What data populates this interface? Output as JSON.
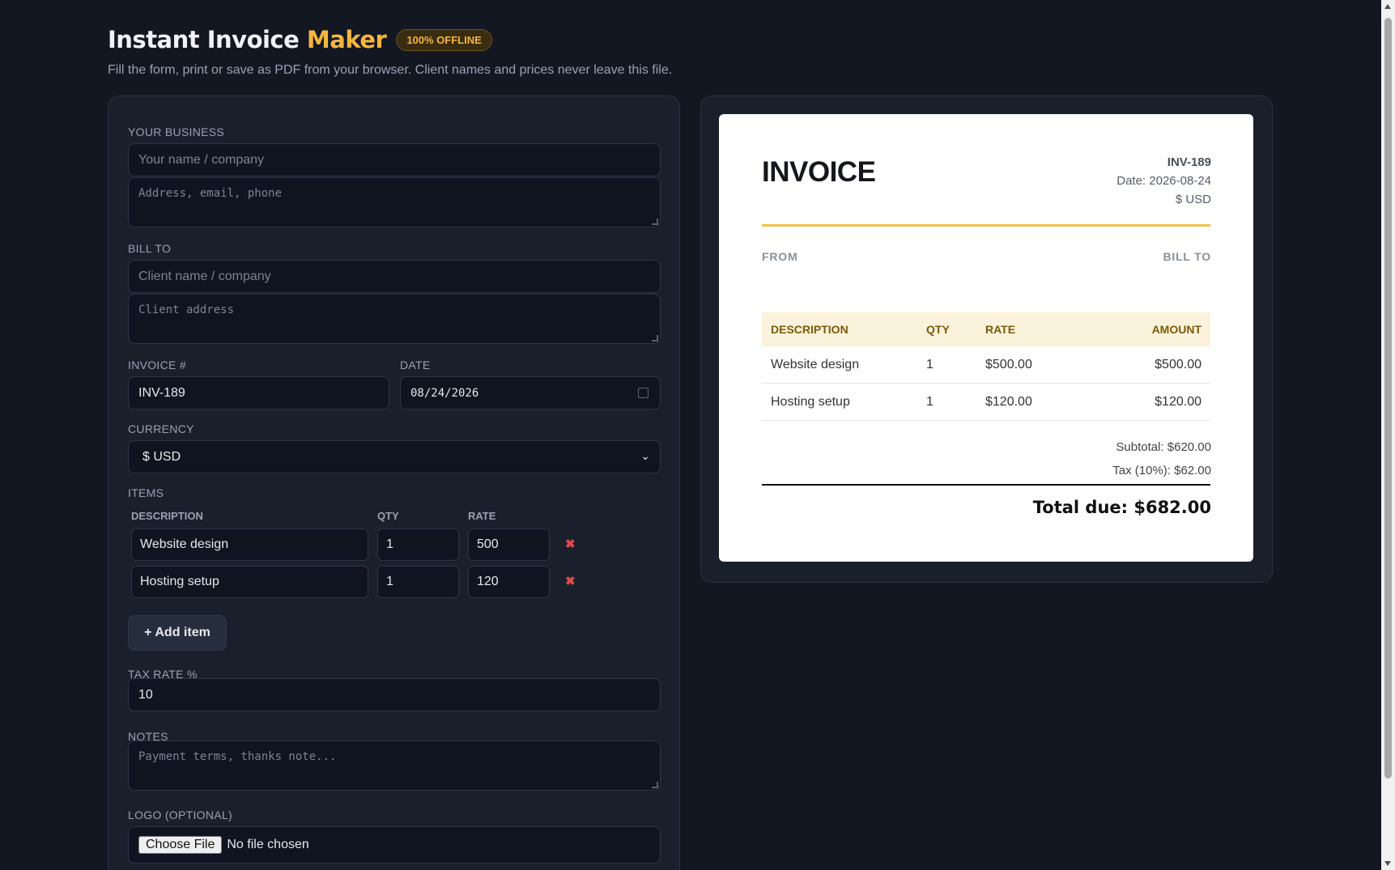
{
  "header": {
    "title_part1": "Instant Invoice",
    "title_accent": "Maker",
    "badge": "100% OFFLINE",
    "subtitle": "Fill the form, print or save as PDF from your browser. Client names and prices never leave this file."
  },
  "form": {
    "business": {
      "label": "YOUR BUSINESS",
      "name_placeholder": "Your name / company",
      "address_placeholder": "Address, email, phone"
    },
    "bill_to": {
      "label": "BILL TO",
      "name_placeholder": "Client name / company",
      "address_placeholder": "Client address"
    },
    "invoice_number": {
      "label": "INVOICE #",
      "value": "INV-189"
    },
    "date": {
      "label": "DATE",
      "value": "08/24/2026"
    },
    "currency": {
      "label": "CURRENCY",
      "value": "$ USD"
    },
    "items": {
      "label": "ITEMS",
      "col_description": "DESCRIPTION",
      "col_qty": "QTY",
      "col_rate": "RATE",
      "rows": [
        {
          "description": "Website design",
          "qty": "1",
          "rate": "500"
        },
        {
          "description": "Hosting setup",
          "qty": "1",
          "rate": "120"
        }
      ],
      "remove_glyph": "✖",
      "add_label": "+ Add item"
    },
    "tax": {
      "label": "TAX RATE %",
      "value": "10"
    },
    "notes": {
      "label": "NOTES",
      "placeholder": "Payment terms, thanks note..."
    },
    "logo": {
      "label": "LOGO (OPTIONAL)",
      "button": "Choose File",
      "status": "No file chosen"
    }
  },
  "preview": {
    "title": "INVOICE",
    "number": "INV-189",
    "date": "Date: 2026-08-24",
    "currency": "$ USD",
    "from_label": "FROM",
    "bill_to_label": "BILL TO",
    "table": {
      "headers": [
        "DESCRIPTION",
        "QTY",
        "RATE",
        "AMOUNT"
      ],
      "rows": [
        {
          "description": "Website design",
          "qty": "1",
          "rate": "$500.00",
          "amount": "$500.00"
        },
        {
          "description": "Hosting setup",
          "qty": "1",
          "rate": "$120.00",
          "amount": "$120.00"
        }
      ]
    },
    "subtotal": "Subtotal: $620.00",
    "tax": "Tax (10%): $62.00",
    "total": "Total due: $682.00"
  },
  "colors": {
    "background": "#131722",
    "accent": "#f4b63f",
    "danger": "#e04a4a"
  }
}
